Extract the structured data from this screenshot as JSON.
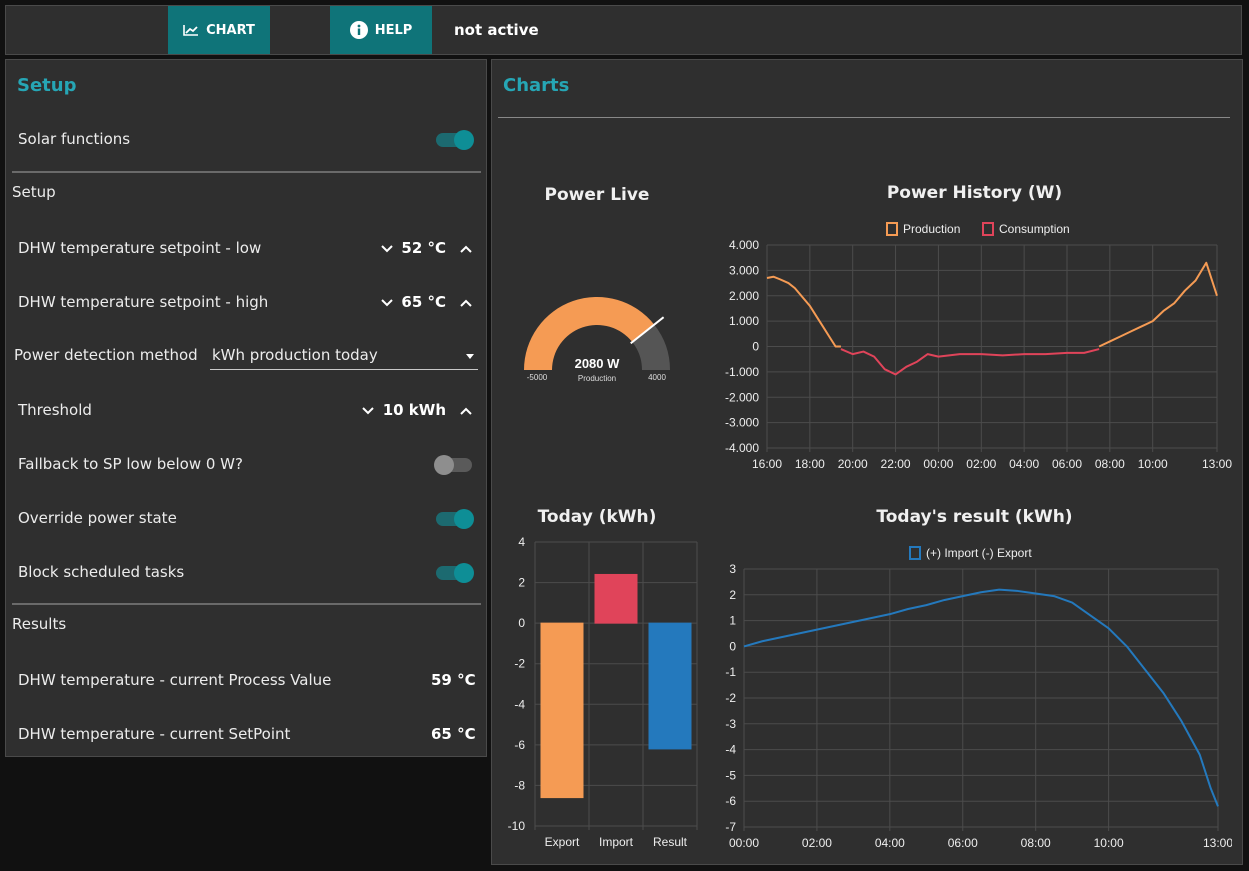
{
  "topbar": {
    "chart_label": "CHART",
    "help_label": "HELP",
    "status": "not active"
  },
  "setup": {
    "title": "Setup",
    "solar_functions": {
      "label": "Solar functions",
      "on": true
    },
    "section_setup": "Setup",
    "sp_low": {
      "label": "DHW temperature setpoint - low",
      "value": "52 °C"
    },
    "sp_high": {
      "label": "DHW temperature setpoint - high",
      "value": "65 °C"
    },
    "power_method": {
      "label": "Power detection method",
      "value": "kWh production today"
    },
    "threshold": {
      "label": "Threshold",
      "value": "10 kWh"
    },
    "fallback": {
      "label": "Fallback to SP low below 0 W?",
      "on": false
    },
    "override": {
      "label": "Override power state",
      "on": true
    },
    "block": {
      "label": "Block scheduled tasks",
      "on": true
    },
    "section_results": "Results",
    "pv": {
      "label": "DHW temperature - current Process Value",
      "value": "59 °C"
    },
    "sp": {
      "label": "DHW temperature - current SetPoint",
      "value": "65 °C"
    }
  },
  "charts": {
    "title": "Charts",
    "colors": {
      "production": "#f59b54",
      "consumption": "#e0445a",
      "result": "#2479bd",
      "accent": "#26a6b5",
      "button": "#0f7479"
    }
  },
  "chart_data": [
    {
      "type": "gauge",
      "title": "Power Live",
      "value": 2080,
      "value_label": "2080 W",
      "sublabel": "Production",
      "min": -5000,
      "max": 4000,
      "min_label": "-5000",
      "max_label": "4000"
    },
    {
      "type": "line",
      "title": "Power History (W)",
      "legend": [
        "Production",
        "Consumption"
      ],
      "x_ticks": [
        "16:00",
        "18:00",
        "20:00",
        "22:00",
        "00:00",
        "02:00",
        "04:00",
        "06:00",
        "08:00",
        "10:00",
        "13:00"
      ],
      "y_ticks": [
        "4.000",
        "3.000",
        "2.000",
        "1.000",
        "0",
        "-1.000",
        "-2.000",
        "-3.000",
        "-4.000"
      ],
      "ylim": [
        -4000,
        4000
      ],
      "series": [
        {
          "name": "Production",
          "x_hours": [
            0,
            0.3,
            0.6,
            1,
            1.3,
            1.6,
            2,
            2.3,
            2.6,
            2.9,
            3.2,
            3.45
          ],
          "y": [
            2700,
            2750,
            2650,
            2500,
            2300,
            2000,
            1600,
            1200,
            800,
            400,
            0,
            0
          ]
        },
        {
          "name": "Consumption",
          "x_hours": [
            3.45,
            4,
            4.5,
            5,
            5.5,
            6,
            6.5,
            7,
            7.5,
            8,
            9,
            10,
            11,
            12,
            13,
            14,
            14.8,
            15.5
          ],
          "y": [
            -100,
            -300,
            -200,
            -400,
            -900,
            -1100,
            -800,
            -600,
            -300,
            -400,
            -300,
            -300,
            -350,
            -300,
            -300,
            -250,
            -250,
            -100
          ]
        },
        {
          "name": "Production",
          "x_hours": [
            15.5,
            16,
            16.5,
            17,
            17.5,
            18,
            18.5,
            19,
            19.5,
            20,
            20.5,
            21
          ],
          "y": [
            0,
            200,
            400,
            600,
            800,
            1000,
            1400,
            1700,
            2200,
            2600,
            3300,
            2000
          ]
        }
      ]
    },
    {
      "type": "bar",
      "title": "Today (kWh)",
      "categories": [
        "Export",
        "Import",
        "Result"
      ],
      "values": [
        -8.6,
        2.4,
        -6.2
      ],
      "y_ticks": [
        "4",
        "2",
        "0",
        "-2",
        "-4",
        "-6",
        "-8",
        "-10"
      ],
      "ylim": [
        -10,
        4
      ]
    },
    {
      "type": "line",
      "title": "Today's result (kWh)",
      "legend": [
        "(+) Import (-) Export"
      ],
      "x_ticks": [
        "00:00",
        "02:00",
        "04:00",
        "06:00",
        "08:00",
        "10:00",
        "13:00"
      ],
      "y_ticks": [
        "3",
        "2",
        "1",
        "0",
        "-1",
        "-2",
        "-3",
        "-4",
        "-5",
        "-6",
        "-7"
      ],
      "ylim": [
        -7,
        3
      ],
      "series": [
        {
          "name": "(+) Import (-) Export",
          "x_hours": [
            0,
            0.5,
            1,
            1.5,
            2,
            2.5,
            3,
            3.5,
            4,
            4.5,
            5,
            5.5,
            6,
            6.5,
            7,
            7.5,
            8,
            8.5,
            9,
            9.5,
            10,
            10.5,
            11,
            11.5,
            12,
            12.5,
            12.8,
            13
          ],
          "y": [
            0,
            0.2,
            0.35,
            0.5,
            0.65,
            0.8,
            0.95,
            1.1,
            1.25,
            1.45,
            1.6,
            1.8,
            1.95,
            2.1,
            2.2,
            2.15,
            2.05,
            1.95,
            1.7,
            1.2,
            0.7,
            0,
            -0.9,
            -1.8,
            -2.9,
            -4.2,
            -5.5,
            -6.2
          ]
        }
      ]
    }
  ]
}
